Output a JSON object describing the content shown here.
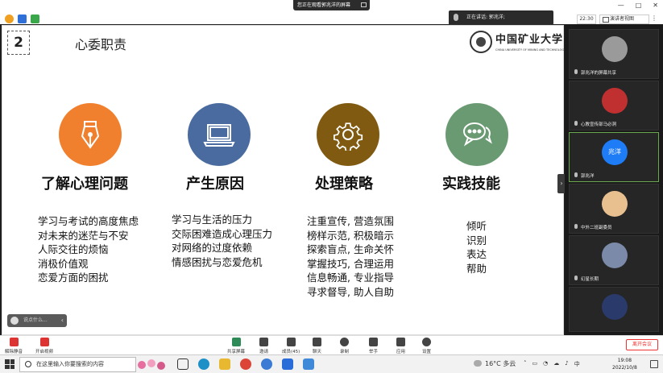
{
  "topbar": {
    "watching_banner": "您正在观看郭兆洋的屏幕",
    "speaking": "正在讲话: 郭兆洋;",
    "time": "22:30",
    "view_mode": "演讲者视图"
  },
  "slide": {
    "number": "2",
    "title": "心委职责",
    "logo_text": "中国矿业大学",
    "logo_en": "CHINA UNIVERSITY OF MINING AND TECHNOLOGY",
    "cards": [
      {
        "heading": "了解心理问题",
        "color": "#f07f2e",
        "icon": "pen-nib-icon",
        "items": [
          "学习与考试的高度焦虑",
          "对未来的迷茫与不安",
          "人际交往的烦恼",
          "消极价值观",
          "恋爱方面的困扰"
        ]
      },
      {
        "heading": "产生原因",
        "color": "#4a6ba0",
        "icon": "laptop-icon",
        "items": [
          "学习与生活的压力",
          "交际困难造成心理压力",
          "对网络的过度依赖",
          "情感困扰与恋爱危机"
        ]
      },
      {
        "heading": "处理策略",
        "color": "#7f5a10",
        "icon": "gear-icon",
        "items": [
          "注重宣传, 营造氛围",
          "榜样示范, 积极暗示",
          "探索盲点, 生命关怀",
          "掌握技巧, 合理运用",
          "信息畅通, 专业指导",
          "寻求督导, 助人自助"
        ]
      },
      {
        "heading": "实践技能",
        "color": "#6a9a72",
        "icon": "chat-bubbles-icon",
        "items": [
          "倾听",
          "识别",
          "表达",
          "帮助"
        ]
      }
    ]
  },
  "chat": {
    "placeholder": "说点什么..."
  },
  "participants": [
    {
      "name": "郭兆洋的屏幕共享",
      "color": "#9a9a9a",
      "label": ""
    },
    {
      "name": "心教宣传部马必洞",
      "color": "#c03030",
      "label": ""
    },
    {
      "name": "郭兆洋",
      "color": "#1e7cf7",
      "label": "兆洋"
    },
    {
      "name": "中外二班副委员",
      "color": "#e8c090",
      "label": ""
    },
    {
      "name": "幻星长期",
      "color": "#7a8aa8",
      "label": ""
    },
    {
      "name": "",
      "color": "#2a3a6a",
      "label": ""
    }
  ],
  "toolbar": {
    "mute": "解除静音",
    "video": "开启视频",
    "share": "共享屏幕",
    "invite": "邀请",
    "members": "成员(45)",
    "chat": "聊天",
    "record": "录制",
    "hand": "举手",
    "apps": "应用",
    "settings": "设置",
    "end": "离开会议"
  },
  "taskbar": {
    "search_placeholder": "在这里输入你要搜索的内容",
    "weather": "16°C 多云",
    "time": "19:08",
    "date": "2022/10/8",
    "ime": "中"
  }
}
